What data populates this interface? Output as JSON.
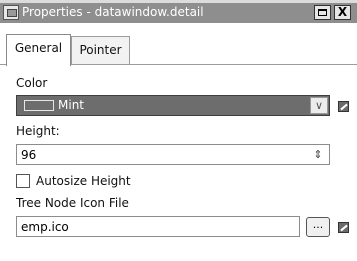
{
  "window": {
    "title": "Properties - datawindow.detail",
    "close_glyph": "X"
  },
  "tabs": [
    {
      "label": "General",
      "active": true
    },
    {
      "label": "Pointer",
      "active": false
    }
  ],
  "general": {
    "color_label": "Color",
    "color_value": "Mint",
    "height_label": "Height:",
    "height_value": "96",
    "autosize_label": "Autosize Height",
    "autosize_checked": false,
    "tree_icon_label": "Tree Node Icon File",
    "tree_icon_value": "emp.ico",
    "browse_label": "..."
  },
  "icons": {
    "app": "properties-window-icon",
    "maximize": "maximize-icon",
    "close": "close-icon",
    "dropdown": "chevron-down-icon",
    "expression": "expression-wand-icon",
    "spinner": "spin-updown-icon"
  }
}
